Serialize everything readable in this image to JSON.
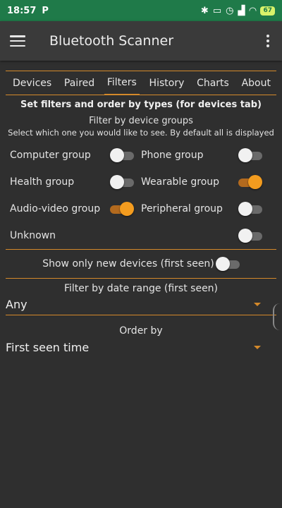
{
  "statusbar": {
    "time": "18:57",
    "notification_icon": "P",
    "battery": "67"
  },
  "appbar": {
    "title": "Bluetooth Scanner"
  },
  "tabs": [
    "Devices",
    "Paired",
    "Filters",
    "History",
    "Charts",
    "About"
  ],
  "filters": {
    "heading": "Set filters and order by types (for devices tab)",
    "groups_title": "Filter by device groups",
    "groups_hint": "Select which one you would like to see. By default all is displayed",
    "groups": [
      {
        "label": "Computer group",
        "on": false
      },
      {
        "label": "Phone group",
        "on": false
      },
      {
        "label": "Health group",
        "on": false
      },
      {
        "label": "Wearable group",
        "on": true
      },
      {
        "label": "Audio-video group",
        "on": true
      },
      {
        "label": "Peripheral group",
        "on": false
      },
      {
        "label": "Unknown",
        "on": false
      }
    ],
    "new_devices_label": "Show only new devices (first seen)",
    "new_devices_on": false,
    "date_range_label": "Filter by date range (first seen)",
    "date_range_value": "Any",
    "order_by_label": "Order by",
    "order_by_value": "First seen time"
  },
  "colors": {
    "accent": "#d4892a",
    "statusbar": "#1f7a49",
    "background": "#2f2f2f"
  }
}
